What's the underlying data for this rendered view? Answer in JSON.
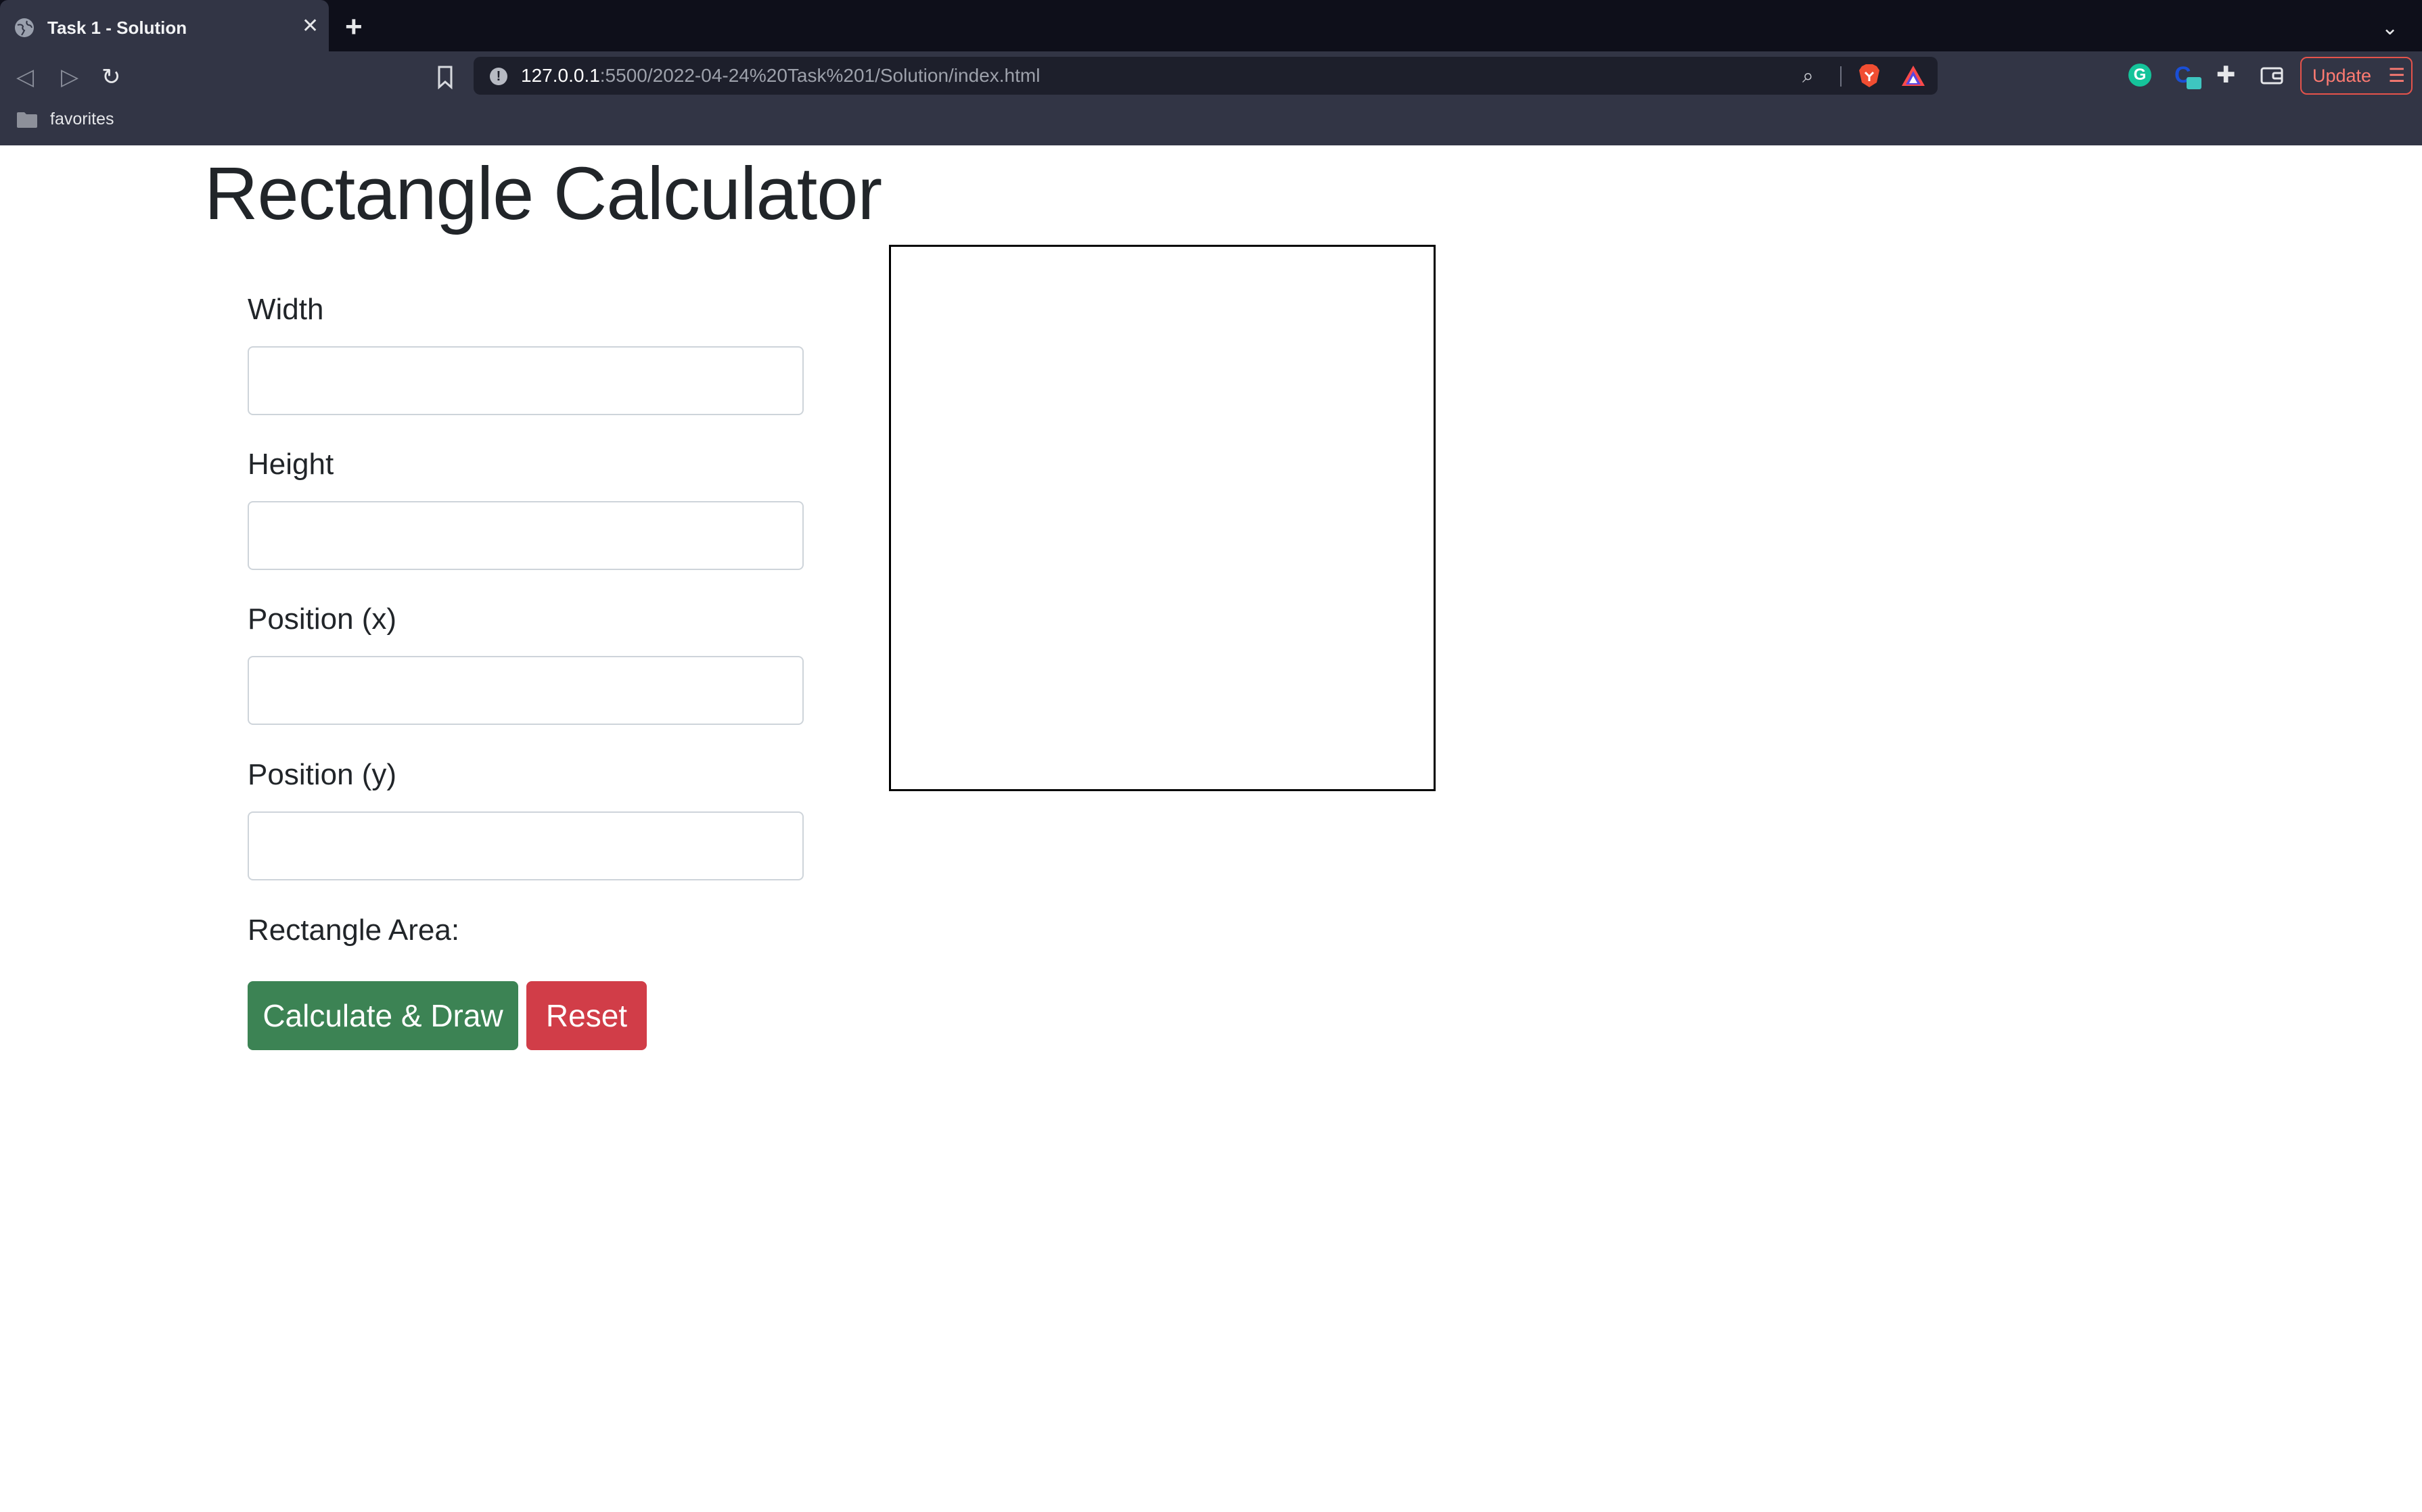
{
  "browser": {
    "tab_title": "Task 1 - Solution",
    "tab_close": "✕",
    "new_tab": "+",
    "url_host": "127.0.0.1",
    "url_path": ":5500/2022-04-24%20Task%201/Solution/index.html",
    "update_label": "Update",
    "bookmark_folder": "favorites",
    "ext_grammarly_letter": "G"
  },
  "page": {
    "title": "Rectangle Calculator",
    "fields": [
      {
        "label": "Width",
        "value": ""
      },
      {
        "label": "Height",
        "value": ""
      },
      {
        "label": "Position (x)",
        "value": ""
      },
      {
        "label": "Position (y)",
        "value": ""
      }
    ],
    "area_label": "Rectangle Area:",
    "calculate_label": "Calculate & Draw",
    "reset_label": "Reset"
  },
  "colors": {
    "calculate_button": "#3c8354",
    "reset_button": "#d13d48",
    "chrome_dark": "#0e0f1a",
    "chrome_toolbar": "#323545"
  }
}
